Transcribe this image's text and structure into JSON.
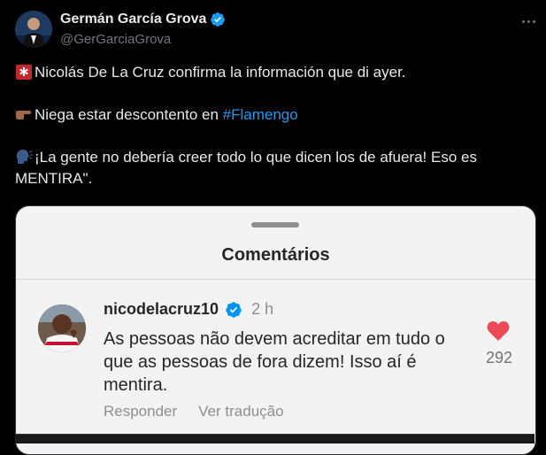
{
  "tweet": {
    "author": {
      "display_name": "Germán García Grova",
      "handle": "@GerGarciaGrova",
      "verified_color": "#1d9bf0"
    },
    "more_icon": "more-horizontal-icon",
    "lines": {
      "line1_emoji": "rotating-light-icon",
      "line1": "Nicolás De La Cruz confirma la información que di ayer.",
      "line2_emoji": "pointing-right-icon",
      "line2_prefix": "Niega estar descontento en ",
      "line2_hashtag": "#Flamengo",
      "line3_emoji": "speaking-head-icon",
      "line3": "¡La gente no debería creer todo lo que dicen los de afuera! Eso es MENTIRA\"."
    },
    "hashtag_color": "#1d9bf0"
  },
  "media": {
    "sheet_title": "Comentários",
    "comment": {
      "username": "nicodelacruz10",
      "time": "2 h",
      "text": "As pessoas não devem acreditar em tudo o que as pessoas de fora dizem! Isso aí é mentira.",
      "reply_label": "Responder",
      "translate_label": "Ver tradução",
      "like_count": "292",
      "like_icon": "heart-filled-icon",
      "like_color": "#ed4956",
      "verified_color": "#0095f6"
    }
  }
}
